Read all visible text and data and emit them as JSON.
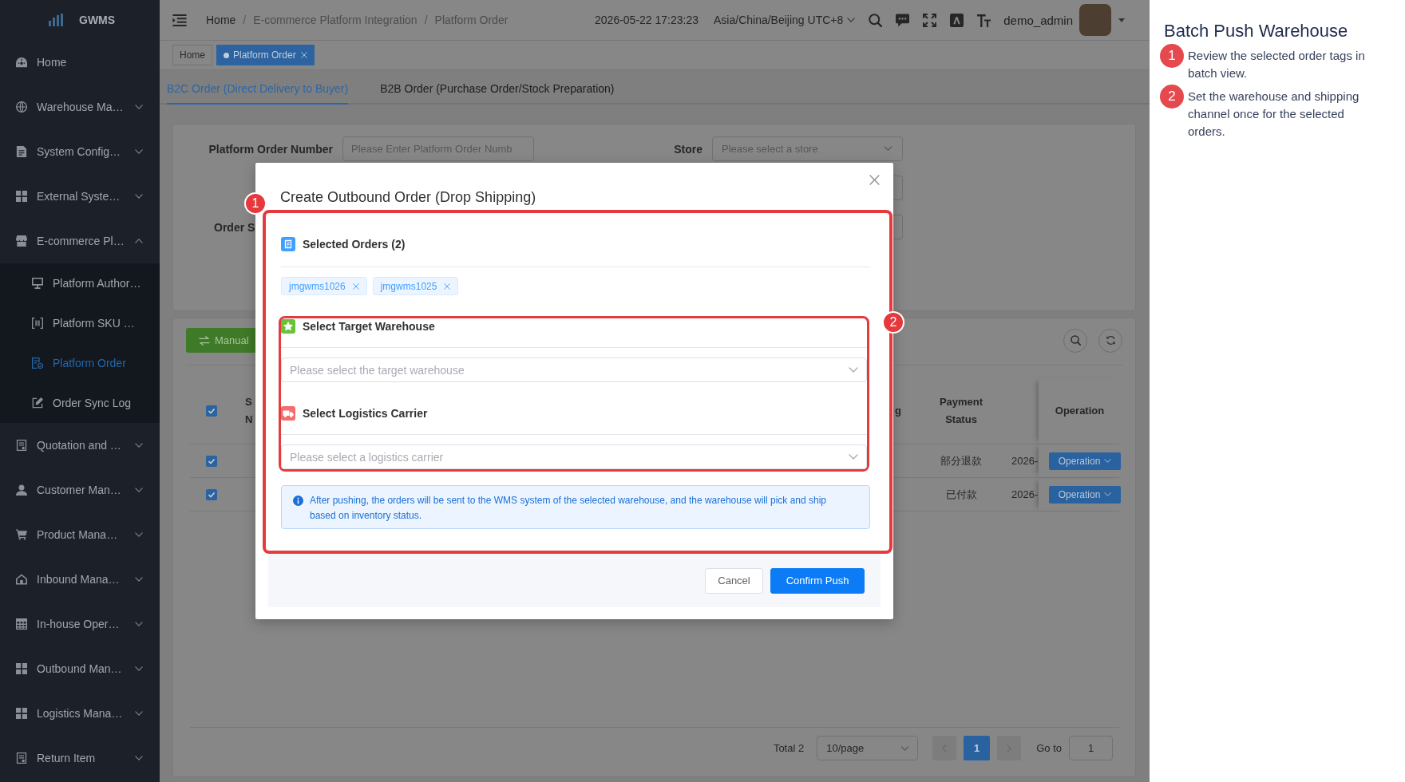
{
  "sidebar": {
    "logo": "GWMS",
    "items": [
      {
        "label": "Home",
        "kind": "link",
        "selected": false
      },
      {
        "label": "Warehouse Ma…",
        "kind": "group",
        "expanded": false,
        "selected": false
      },
      {
        "label": "System Config…",
        "kind": "group",
        "expanded": false,
        "selected": false
      },
      {
        "label": "External Syste…",
        "kind": "group",
        "expanded": false,
        "selected": false
      },
      {
        "label": "E-commerce Pl…",
        "kind": "group",
        "expanded": true,
        "selected": false,
        "children": [
          {
            "label": "Platform Author…",
            "selected": false
          },
          {
            "label": "Platform SKU …",
            "selected": false
          },
          {
            "label": "Platform Order",
            "selected": true
          },
          {
            "label": "Order Sync Log",
            "selected": false
          }
        ]
      },
      {
        "label": "Quotation and …",
        "kind": "group",
        "expanded": false,
        "selected": false
      },
      {
        "label": "Customer Man…",
        "kind": "group",
        "expanded": false,
        "selected": false
      },
      {
        "label": "Product Mana…",
        "kind": "group",
        "expanded": false,
        "selected": false
      },
      {
        "label": "Inbound Mana…",
        "kind": "group",
        "expanded": false,
        "selected": false
      },
      {
        "label": "In-house Oper…",
        "kind": "group",
        "expanded": false,
        "selected": false
      },
      {
        "label": "Outbound Man…",
        "kind": "group",
        "expanded": false,
        "selected": false
      },
      {
        "label": "Logistics Mana…",
        "kind": "group",
        "expanded": false,
        "selected": false
      },
      {
        "label": "Return Item",
        "kind": "group",
        "expanded": false,
        "selected": false
      }
    ]
  },
  "header": {
    "breadcrumb": [
      {
        "label": "Home",
        "link": true
      },
      {
        "label": "E-commerce Platform Integration",
        "link": false
      },
      {
        "label": "Platform Order",
        "link": false
      }
    ],
    "separator": "/",
    "datetime": "2026-05-22 17:23:23",
    "timezone": "Asia/China/Beijing UTC+8",
    "user": "demo_admin"
  },
  "tags_view": [
    {
      "label": "Home",
      "selected": false,
      "closable": false
    },
    {
      "label": "Platform Order",
      "selected": true,
      "closable": true
    }
  ],
  "tabs": [
    {
      "label": "B2C Order (Direct Delivery to Buyer)",
      "selected": true
    },
    {
      "label": "B2B Order (Purchase Order/Stock Preparation)",
      "selected": false
    }
  ],
  "search_form": {
    "rows": [
      [
        {
          "kind": "input",
          "label": "Platform Order Number",
          "placeholder": "Please Enter Platform Order Numb"
        },
        {
          "kind": "select",
          "label": "Store",
          "placeholder": "Please select a store"
        }
      ],
      [
        {
          "kind": "covered"
        }
      ],
      [
        {
          "kind": "label",
          "label": "Order S"
        },
        {
          "kind": "covered"
        }
      ]
    ]
  },
  "table": {
    "toolbar": {
      "buttons": [
        {
          "label": "Manual",
          "kind": "success"
        }
      ]
    },
    "all_selected": true,
    "columns": [
      {
        "label": "S N"
      },
      {
        "label": "g"
      },
      {
        "label": "Payment Status"
      },
      {
        "label": "Operation"
      }
    ],
    "rows": [
      {
        "selected": true,
        "payment_status": "部分退款",
        "column_5": "2026-",
        "action": "Operation"
      },
      {
        "selected": true,
        "payment_status": "已付款",
        "column_5": "2026-",
        "action": "Operation"
      }
    ]
  },
  "pagination": {
    "total": "Total 2",
    "page_size": "10/page",
    "prev": {
      "disabled": true
    },
    "pages": [
      {
        "label": "1",
        "selected": true
      }
    ],
    "next": {
      "disabled": true
    },
    "jump_label": "Go to",
    "jump_value": "1"
  },
  "modal": {
    "title": "Create Outbound Order (Drop Shipping)",
    "annotations": [
      {
        "number": "1"
      },
      {
        "number": "2"
      }
    ],
    "sections": [
      {
        "kind": "tags",
        "title": "Selected Orders (2)",
        "color": "#409eff",
        "tags": [
          "jmgwms1026",
          "jmgwms1025"
        ]
      },
      {
        "kind": "select",
        "title": "Select Target Warehouse",
        "color": "#67c23a",
        "placeholder": "Please select the target warehouse"
      },
      {
        "kind": "select",
        "title": "Select Logistics Carrier",
        "color": "#f56c6c",
        "placeholder": "Please select a logistics carrier"
      }
    ],
    "notice": "After pushing, the orders will be sent to the WMS system of the selected warehouse, and the warehouse will pick and ship based on inventory status.",
    "buttons": [
      {
        "label": "Cancel",
        "kind": "default"
      },
      {
        "label": "Confirm Push",
        "kind": "primary"
      }
    ]
  },
  "guide": {
    "title": "Batch Push Warehouse",
    "steps": [
      {
        "number": "1",
        "text": "Review the selected order tags in batch view."
      },
      {
        "number": "2",
        "text": "Set the warehouse and shipping channel once for the selected orders."
      }
    ]
  }
}
